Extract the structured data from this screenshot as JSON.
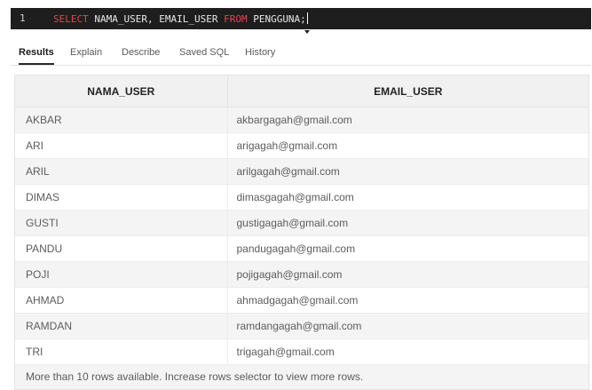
{
  "editor": {
    "line_number": "1",
    "kw_select": "SELECT",
    "columns": " NAMA_USER, EMAIL_USER ",
    "kw_from": "FROM",
    "table": " PENGGUNA;"
  },
  "tabs": [
    {
      "label": "Results",
      "active": true
    },
    {
      "label": "Explain",
      "active": false
    },
    {
      "label": "Describe",
      "active": false
    },
    {
      "label": "Saved SQL",
      "active": false
    },
    {
      "label": "History",
      "active": false
    }
  ],
  "results": {
    "columns": [
      "NAMA_USER",
      "EMAIL_USER"
    ],
    "rows": [
      [
        "AKBAR",
        "akbargagah@gmail.com"
      ],
      [
        "ARI",
        "arigagah@gmail.com"
      ],
      [
        "ARIL",
        "arilgagah@gmail.com"
      ],
      [
        "DIMAS",
        "dimasgagah@gmail.com"
      ],
      [
        "GUSTI",
        "gustigagah@gmail.com"
      ],
      [
        "PANDU",
        "pandugagah@gmail.com"
      ],
      [
        "POJI",
        "pojigagah@gmail.com"
      ],
      [
        "AHMAD",
        "ahmadgagah@gmail.com"
      ],
      [
        "RAMDAN",
        "ramdangagah@gmail.com"
      ],
      [
        "TRI",
        "trigagah@gmail.com"
      ]
    ],
    "footer": "More than 10 rows available. Increase rows selector to view more rows."
  }
}
